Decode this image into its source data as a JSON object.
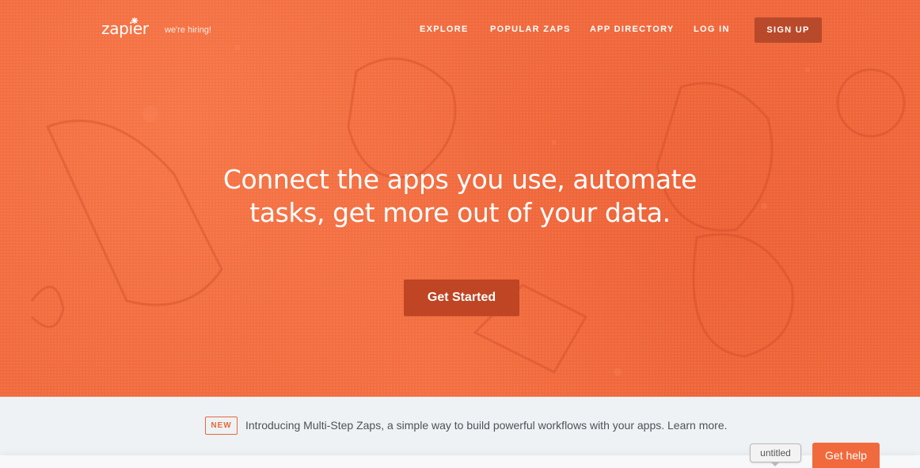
{
  "header": {
    "logo_text": "zapier",
    "hiring_text": "we're hiring!",
    "nav": {
      "explore": "EXPLORE",
      "popular_zaps": "POPULAR ZAPS",
      "app_directory": "APP DIRECTORY",
      "log_in": "LOG IN",
      "sign_up": "SIGN UP"
    }
  },
  "hero": {
    "headline_line1": "Connect the apps you use, automate",
    "headline_line2": "tasks, get more out of your data.",
    "cta_label": "Get Started",
    "background_color": "#f16a3d"
  },
  "announcement": {
    "badge": "NEW",
    "text": "Introducing Multi-Step Zaps, a simple way to build powerful workflows with your apps. Learn more."
  },
  "widgets": {
    "tooltip_text": "untitled",
    "help_button": "Get help"
  },
  "colors": {
    "brand_orange": "#f16a3d",
    "button_dark": "#bf4524",
    "signup_bg": "#b84a2b"
  }
}
